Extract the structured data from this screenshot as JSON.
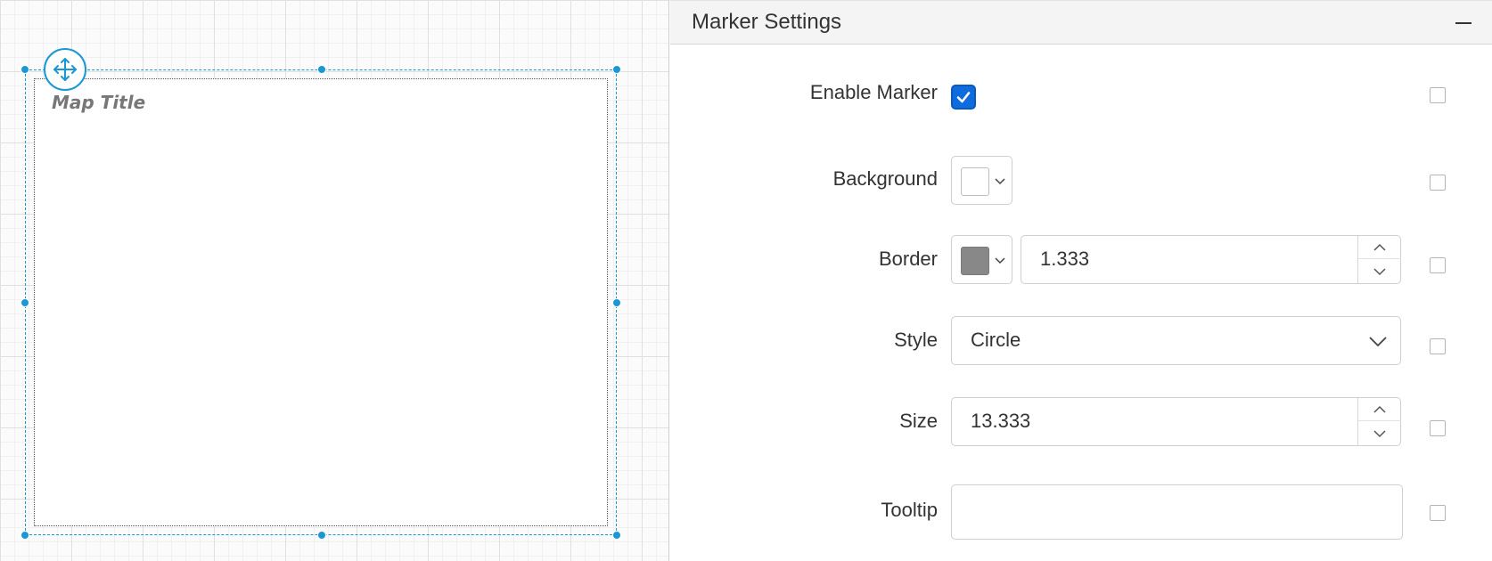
{
  "map": {
    "title": "Map Title",
    "land_color": "#d2e9f1",
    "land_border_color": "#555555",
    "marker_fill": "#ffffff",
    "marker_border": "#888888"
  },
  "panel": {
    "title": "Marker Settings",
    "enable_marker": {
      "label": "Enable Marker",
      "checked": true
    },
    "background": {
      "label": "Background",
      "color": "#ffffff"
    },
    "border": {
      "label": "Border",
      "color": "#888888",
      "width": "1.333"
    },
    "style": {
      "label": "Style",
      "value": "Circle"
    },
    "size": {
      "label": "Size",
      "value": "13.333"
    },
    "tooltip": {
      "label": "Tooltip",
      "value": ""
    }
  },
  "icons": {
    "move": "move-arrows-icon",
    "collapse": "minus-icon",
    "check": "check-icon",
    "dropdown": "chevron-down-icon",
    "spin_up": "chevron-up-icon",
    "spin_down": "chevron-down-icon"
  }
}
